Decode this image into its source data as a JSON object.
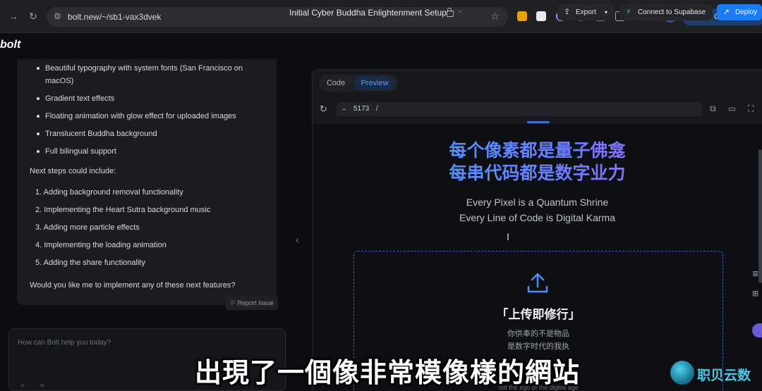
{
  "browser": {
    "url": "bolt.new/~/sb1-vax3dvek",
    "profile_initial": "S",
    "update_label": "有新版 Chrome 可用"
  },
  "header": {
    "logo": "bolt",
    "project_title": "Initial Cyber Buddha Enlightenment Setup",
    "export_label": "Export",
    "supabase_label": "Connect to Supabase",
    "deploy_label": "Deploy"
  },
  "chat": {
    "features": [
      "Beautiful typography with system fonts (San Francisco on macOS)",
      "Gradient text effects",
      "Floating animation with glow effect for uploaded images",
      "Translucent Buddha background",
      "Full bilingual support"
    ],
    "next_steps_heading": "Next steps could include:",
    "next_steps": [
      "1. Adding background removal functionality",
      "2. Implementing the Heart Sutra background music",
      "3. Adding more particle effects",
      "4. Implementing the loading animation",
      "5. Adding the share functionality"
    ],
    "question": "Would you like me to implement any of these next features?",
    "report_label": "Report Issue",
    "input_placeholder": "How can Bolt help you today?"
  },
  "workbench": {
    "tab_code": "Code",
    "tab_preview": "Preview",
    "port": "5173",
    "path": "/"
  },
  "preview": {
    "title_line1": "每个像素都是量子佛龛",
    "title_line2": "每串代码都是数字业力",
    "subtitle_line1": "Every Pixel is a Quantum Shrine",
    "subtitle_line2": "Every Line of Code is Digital Karma",
    "upload_title": "「上传即修行」",
    "upload_sub1": "你供奉的不是物品",
    "upload_sub2": "是数字时代的我执",
    "upload_faded": "not the ego of the digital age"
  },
  "overlay": {
    "caption": "出現了一個像非常模像樣的網站",
    "watermark": "职贝云数"
  },
  "colors": {
    "accent": "#1b7bf2",
    "gradient_start": "#3aa8ff",
    "gradient_end": "#b65cf0"
  }
}
